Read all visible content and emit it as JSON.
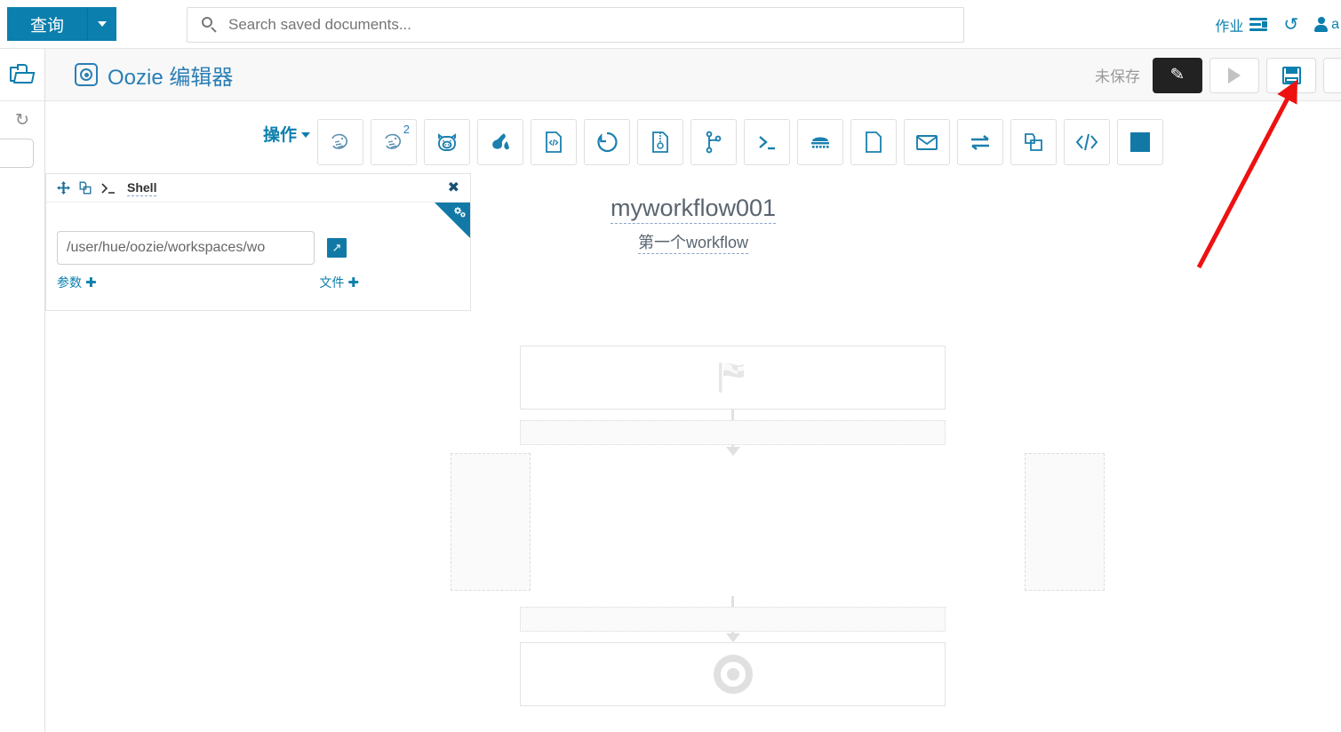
{
  "navbar": {
    "query_button": "查询",
    "query_caret_icon": "chevron-down-icon",
    "search": {
      "placeholder": "Search saved documents...",
      "value": "",
      "icon": "search-icon"
    },
    "jobs_label": "作业",
    "jobs_icon": "list-icon",
    "history_icon": "history-icon",
    "user_icon": "user-icon",
    "user_label": "a"
  },
  "sidebar": {
    "folder_icon": "folder-open-icon",
    "refresh_icon": "refresh-icon",
    "search_placeholder": ""
  },
  "editor_header": {
    "app_icon": "oozie-circle-icon",
    "title": "Oozie 编辑器",
    "status": "未保存",
    "buttons": [
      {
        "name": "edit-button",
        "icon": "pencil-icon",
        "state": "active"
      },
      {
        "name": "run-button",
        "icon": "play-icon",
        "state": "disabled"
      },
      {
        "name": "save-button",
        "icon": "floppy-disk-icon",
        "state": "normal"
      }
    ]
  },
  "action_bar": {
    "label": "操作",
    "caret_icon": "chevron-down-icon",
    "actions": [
      {
        "name": "action-hive",
        "icon": "hive-elephant-icon",
        "sup": ""
      },
      {
        "name": "action-hive2",
        "icon": "hive-elephant-icon",
        "sup": "2"
      },
      {
        "name": "action-pig",
        "icon": "pig-icon",
        "sup": ""
      },
      {
        "name": "action-spark",
        "icon": "spark-star-icon",
        "sup": ""
      },
      {
        "name": "action-java",
        "icon": "code-file-icon",
        "sup": ""
      },
      {
        "name": "action-sqoop",
        "icon": "circle-arrow-icon",
        "sup": ""
      },
      {
        "name": "action-distcp-file",
        "icon": "zip-file-icon",
        "sup": ""
      },
      {
        "name": "action-fork",
        "icon": "branch-icon",
        "sup": ""
      },
      {
        "name": "action-shell",
        "icon": "terminal-prompt-icon",
        "sup": ""
      },
      {
        "name": "action-mapreduce",
        "icon": "hadoop-icon",
        "sup": ""
      },
      {
        "name": "action-file",
        "icon": "document-icon",
        "sup": ""
      },
      {
        "name": "action-email",
        "icon": "envelope-icon",
        "sup": ""
      },
      {
        "name": "action-transfer",
        "icon": "two-arrows-icon",
        "sup": ""
      },
      {
        "name": "action-copy",
        "icon": "copy-pages-icon",
        "sup": ""
      },
      {
        "name": "action-code",
        "icon": "angle-brackets-icon",
        "sup": ""
      },
      {
        "name": "action-stop",
        "icon": "filled-square-icon",
        "sup": ""
      }
    ]
  },
  "workflow": {
    "title": "myworkflow001",
    "subtitle": "第一个workflow",
    "start_node": {
      "name": "start-node",
      "icon": "checkered-flag-icon"
    },
    "end_node": {
      "name": "end-node",
      "icon": "bullseye-icon"
    },
    "shell_node": {
      "move_icon": "move-arrows-icon",
      "copy_icon": "copy-pages-icon",
      "type_icon": "terminal-prompt-icon",
      "label": "Shell",
      "close_icon": "close-icon",
      "path_value": "/user/hue/oozie/workspaces/wo",
      "browse_icon": "external-link-icon",
      "params_label": "参数",
      "files_label": "文件",
      "plus_icon": "plus-icon",
      "settings_icon": "gears-icon"
    }
  },
  "annotation": {
    "type": "red-arrow",
    "color": "#ee1111",
    "points_to": "save-button"
  }
}
